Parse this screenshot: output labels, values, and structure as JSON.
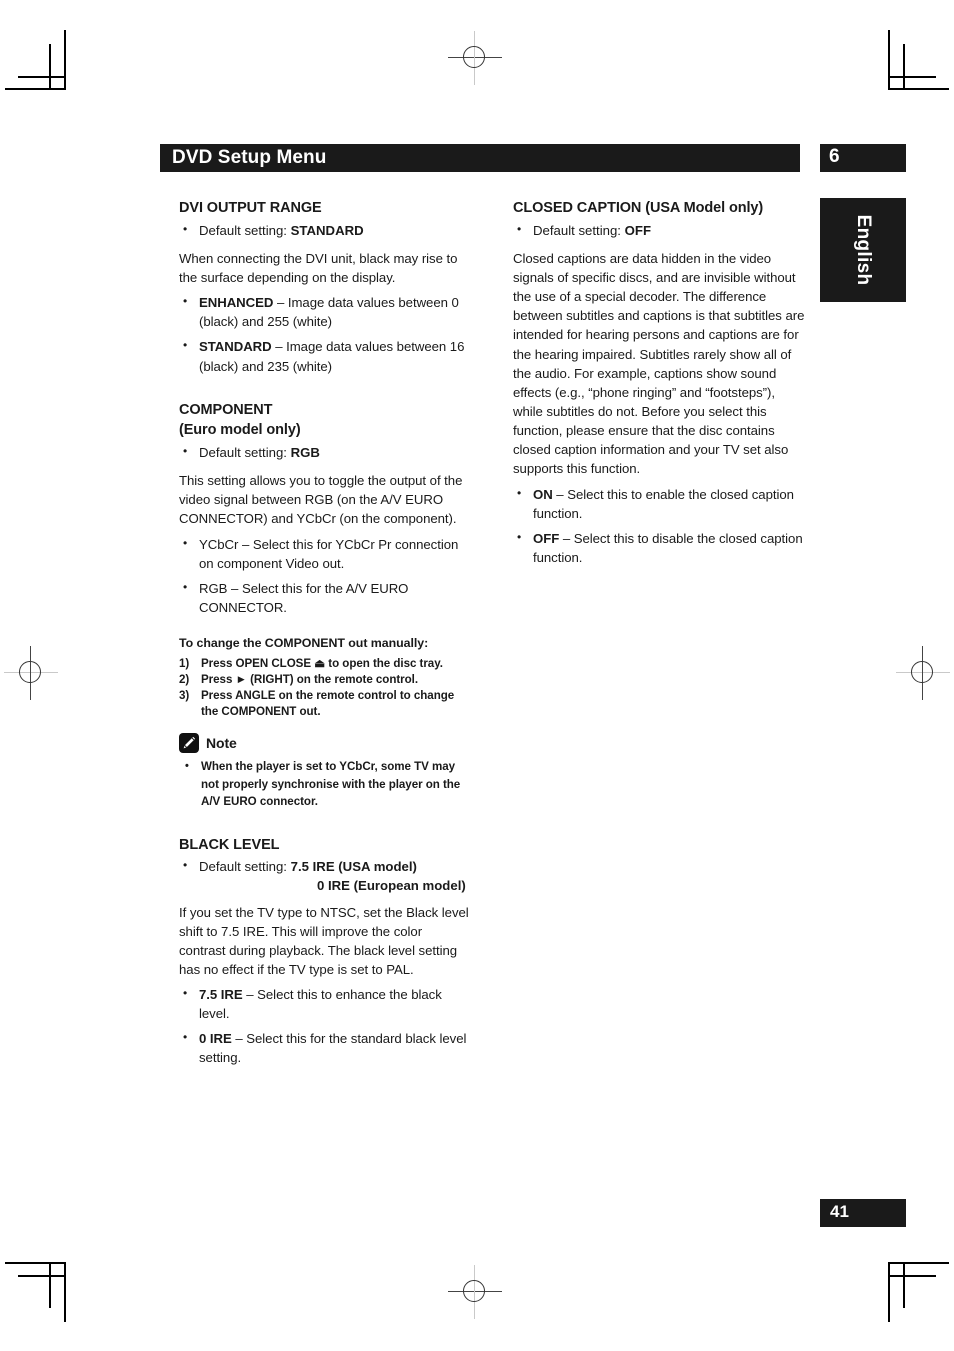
{
  "header": {
    "title": "DVD Setup Menu",
    "chapter_number": "6",
    "language_tab": "English",
    "page_number": "41",
    "bar_color": "#1a1a1a"
  },
  "left_column": {
    "dvi": {
      "heading": "DVI OUTPUT RANGE",
      "default_label": "Default setting: ",
      "default_value": "STANDARD",
      "body": "When connecting the DVI unit, black may rise to the surface depending on the display.",
      "options": [
        {
          "term": "ENHANCED",
          "desc": " – Image data values between 0 (black) and 255 (white)"
        },
        {
          "term": "STANDARD",
          "desc": " – Image data values between 16 (black) and 235 (white)"
        }
      ]
    },
    "component": {
      "heading": "COMPONENT",
      "subheading": "(Euro model only)",
      "default_label": "Default setting: ",
      "default_value": "RGB",
      "body": "This setting allows you to toggle the output of the video signal between RGB (on the A/V EURO CONNECTOR) and YCbCr (on the component).",
      "options": [
        {
          "term": "YCbCr",
          "desc": " – Select this for YCbCr Pr connection on component Video out."
        },
        {
          "term": "RGB",
          "desc": " – Select this for the A/V EURO CONNECTOR."
        }
      ],
      "procedure_heading": "To change the COMPONENT out manually:",
      "steps": [
        "Press OPEN CLOSE ⏏ to open the disc tray.",
        "Press ► (RIGHT) on the remote control.",
        "Press ANGLE on the remote control to change the COMPONENT out."
      ],
      "note_label": "Note",
      "note_icon": "pencil-icon",
      "notes": [
        "When the player is set to YCbCr, some TV may not properly synchronise with the player on the A/V EURO connector."
      ]
    },
    "black_level": {
      "heading": "BLACK LEVEL",
      "default_label": "Default setting: ",
      "default_value": "7.5 IRE (USA model)",
      "default_value_line2": "0 IRE (European model)",
      "body": "If you set the TV type to NTSC, set the Black level shift to 7.5 IRE. This will improve the color contrast during playback. The black level setting has no effect if the TV type is set to PAL.",
      "options": [
        {
          "term": "7.5 IRE",
          "desc": " – Select this to enhance the black level."
        },
        {
          "term": "0 IRE",
          "desc": " – Select this for the standard black level setting."
        }
      ]
    }
  },
  "right_column": {
    "closed_caption": {
      "heading": "CLOSED CAPTION (USA Model only)",
      "default_label": "Default setting: ",
      "default_value": "OFF",
      "body": "Closed captions are data hidden in the video signals of specific discs, and are invisible without the use of a special decoder. The difference between subtitles and captions is that subtitles are intended for hearing persons and captions are for the hearing impaired. Subtitles rarely show all of the audio. For example, captions show sound effects (e.g., “phone ringing” and “footsteps”), while subtitles do not. Before you select this function, please ensure that the disc contains closed caption information and your TV set also supports this function.",
      "options": [
        {
          "term": "ON",
          "desc": " – Select this to enable the closed caption function."
        },
        {
          "term": "OFF",
          "desc": " – Select this to disable the closed caption function."
        }
      ]
    }
  }
}
